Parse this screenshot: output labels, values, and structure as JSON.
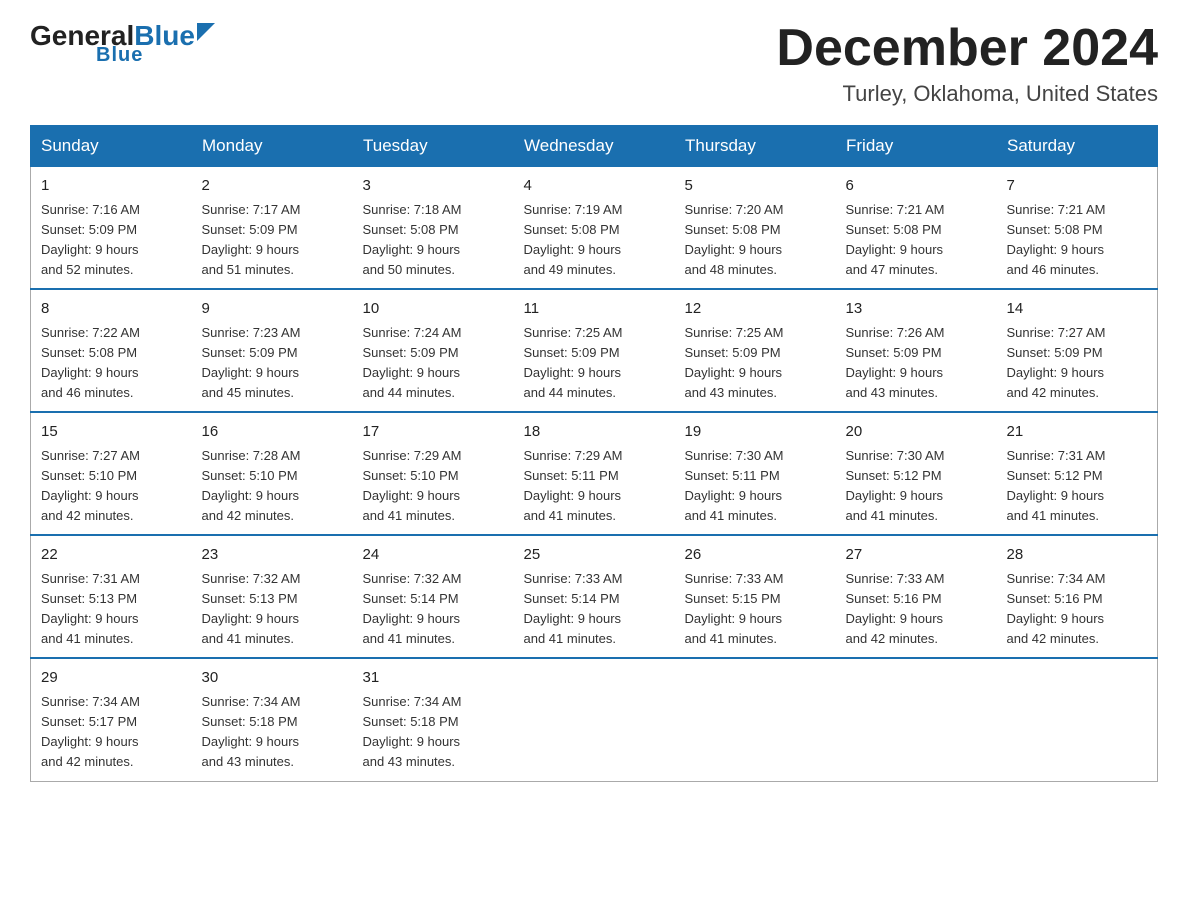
{
  "header": {
    "logo_general": "General",
    "logo_blue": "Blue",
    "month_title": "December 2024",
    "location": "Turley, Oklahoma, United States"
  },
  "days_of_week": [
    "Sunday",
    "Monday",
    "Tuesday",
    "Wednesday",
    "Thursday",
    "Friday",
    "Saturday"
  ],
  "weeks": [
    [
      {
        "day": "1",
        "sunrise": "7:16 AM",
        "sunset": "5:09 PM",
        "daylight": "9 hours and 52 minutes."
      },
      {
        "day": "2",
        "sunrise": "7:17 AM",
        "sunset": "5:09 PM",
        "daylight": "9 hours and 51 minutes."
      },
      {
        "day": "3",
        "sunrise": "7:18 AM",
        "sunset": "5:08 PM",
        "daylight": "9 hours and 50 minutes."
      },
      {
        "day": "4",
        "sunrise": "7:19 AM",
        "sunset": "5:08 PM",
        "daylight": "9 hours and 49 minutes."
      },
      {
        "day": "5",
        "sunrise": "7:20 AM",
        "sunset": "5:08 PM",
        "daylight": "9 hours and 48 minutes."
      },
      {
        "day": "6",
        "sunrise": "7:21 AM",
        "sunset": "5:08 PM",
        "daylight": "9 hours and 47 minutes."
      },
      {
        "day": "7",
        "sunrise": "7:21 AM",
        "sunset": "5:08 PM",
        "daylight": "9 hours and 46 minutes."
      }
    ],
    [
      {
        "day": "8",
        "sunrise": "7:22 AM",
        "sunset": "5:08 PM",
        "daylight": "9 hours and 46 minutes."
      },
      {
        "day": "9",
        "sunrise": "7:23 AM",
        "sunset": "5:09 PM",
        "daylight": "9 hours and 45 minutes."
      },
      {
        "day": "10",
        "sunrise": "7:24 AM",
        "sunset": "5:09 PM",
        "daylight": "9 hours and 44 minutes."
      },
      {
        "day": "11",
        "sunrise": "7:25 AM",
        "sunset": "5:09 PM",
        "daylight": "9 hours and 44 minutes."
      },
      {
        "day": "12",
        "sunrise": "7:25 AM",
        "sunset": "5:09 PM",
        "daylight": "9 hours and 43 minutes."
      },
      {
        "day": "13",
        "sunrise": "7:26 AM",
        "sunset": "5:09 PM",
        "daylight": "9 hours and 43 minutes."
      },
      {
        "day": "14",
        "sunrise": "7:27 AM",
        "sunset": "5:09 PM",
        "daylight": "9 hours and 42 minutes."
      }
    ],
    [
      {
        "day": "15",
        "sunrise": "7:27 AM",
        "sunset": "5:10 PM",
        "daylight": "9 hours and 42 minutes."
      },
      {
        "day": "16",
        "sunrise": "7:28 AM",
        "sunset": "5:10 PM",
        "daylight": "9 hours and 42 minutes."
      },
      {
        "day": "17",
        "sunrise": "7:29 AM",
        "sunset": "5:10 PM",
        "daylight": "9 hours and 41 minutes."
      },
      {
        "day": "18",
        "sunrise": "7:29 AM",
        "sunset": "5:11 PM",
        "daylight": "9 hours and 41 minutes."
      },
      {
        "day": "19",
        "sunrise": "7:30 AM",
        "sunset": "5:11 PM",
        "daylight": "9 hours and 41 minutes."
      },
      {
        "day": "20",
        "sunrise": "7:30 AM",
        "sunset": "5:12 PM",
        "daylight": "9 hours and 41 minutes."
      },
      {
        "day": "21",
        "sunrise": "7:31 AM",
        "sunset": "5:12 PM",
        "daylight": "9 hours and 41 minutes."
      }
    ],
    [
      {
        "day": "22",
        "sunrise": "7:31 AM",
        "sunset": "5:13 PM",
        "daylight": "9 hours and 41 minutes."
      },
      {
        "day": "23",
        "sunrise": "7:32 AM",
        "sunset": "5:13 PM",
        "daylight": "9 hours and 41 minutes."
      },
      {
        "day": "24",
        "sunrise": "7:32 AM",
        "sunset": "5:14 PM",
        "daylight": "9 hours and 41 minutes."
      },
      {
        "day": "25",
        "sunrise": "7:33 AM",
        "sunset": "5:14 PM",
        "daylight": "9 hours and 41 minutes."
      },
      {
        "day": "26",
        "sunrise": "7:33 AM",
        "sunset": "5:15 PM",
        "daylight": "9 hours and 41 minutes."
      },
      {
        "day": "27",
        "sunrise": "7:33 AM",
        "sunset": "5:16 PM",
        "daylight": "9 hours and 42 minutes."
      },
      {
        "day": "28",
        "sunrise": "7:34 AM",
        "sunset": "5:16 PM",
        "daylight": "9 hours and 42 minutes."
      }
    ],
    [
      {
        "day": "29",
        "sunrise": "7:34 AM",
        "sunset": "5:17 PM",
        "daylight": "9 hours and 42 minutes."
      },
      {
        "day": "30",
        "sunrise": "7:34 AM",
        "sunset": "5:18 PM",
        "daylight": "9 hours and 43 minutes."
      },
      {
        "day": "31",
        "sunrise": "7:34 AM",
        "sunset": "5:18 PM",
        "daylight": "9 hours and 43 minutes."
      },
      null,
      null,
      null,
      null
    ]
  ],
  "labels": {
    "sunrise": "Sunrise:",
    "sunset": "Sunset:",
    "daylight": "Daylight:"
  },
  "colors": {
    "header_bg": "#1a6faf",
    "border": "#1a6faf"
  }
}
